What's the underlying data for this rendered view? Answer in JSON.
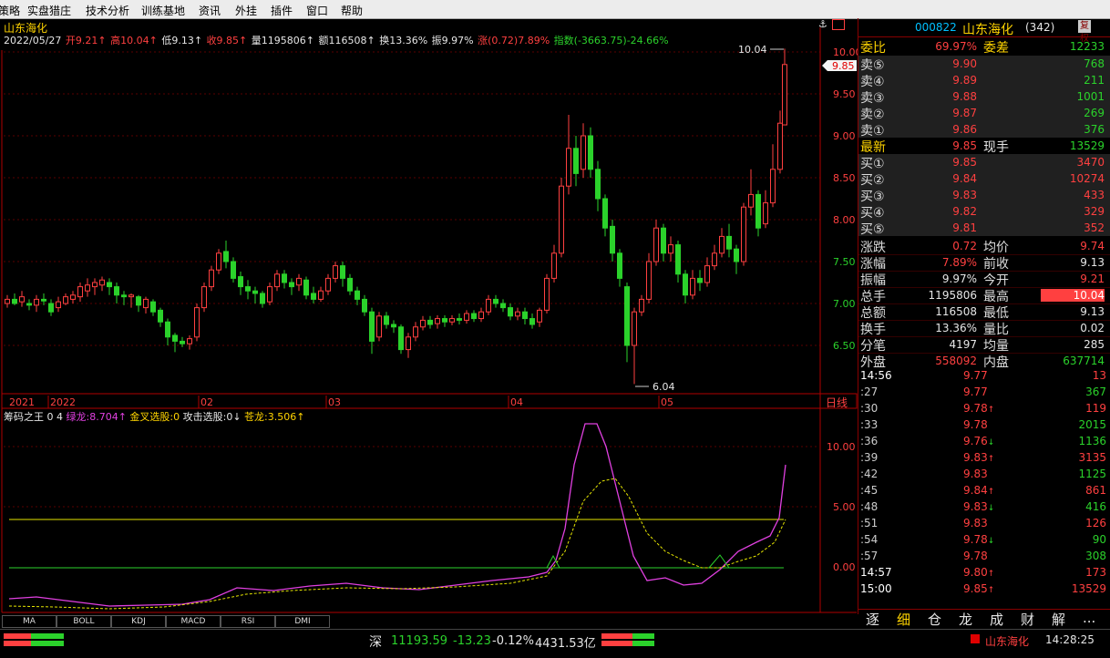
{
  "menu": {
    "items": [
      "策略",
      "实盘猎庄",
      "技术分析",
      "训练基地",
      "资讯",
      "外挂",
      "插件",
      "窗口",
      "帮助"
    ]
  },
  "stock": {
    "name": "山东海化",
    "code": "000822",
    "code_suffix": "(342)",
    "tag": "复权"
  },
  "info": {
    "date": "2022/05/27",
    "open": "开9.21↑",
    "high": "高10.04↑",
    "low": "低9.13↑",
    "close": "收9.85↑",
    "vol": "量1195806↑",
    "amount": "额116508↑",
    "turnover": "换13.36%",
    "amp": "振9.97%",
    "change": "涨(0.72)7.89%",
    "index": "指数(-3663.75)-24.66%"
  },
  "price_axis": {
    "labels": [
      "10.00",
      "9.50",
      "9.00",
      "8.50",
      "8.00",
      "7.50",
      "7.00",
      "6.50"
    ],
    "current_tag": "9.85",
    "high_mark": "10.04",
    "low_mark": "6.04"
  },
  "time_axis": {
    "labels": [
      "2021",
      "2022",
      "02",
      "03",
      "04",
      "05"
    ],
    "period": "日线"
  },
  "indicator": {
    "name": "筹码之王",
    "params": "0  4",
    "line1": "绿龙:8.704↑",
    "line2": "金叉选股:0",
    "line3": "攻击选股:0↓",
    "line4": "苍龙:3.506↑",
    "axis": [
      "10.00",
      "5.00",
      "0.00"
    ]
  },
  "tabs": [
    "MA",
    "BOLL",
    "KDJ",
    "MACD",
    "RSI",
    "DMI"
  ],
  "quote": {
    "weibi": {
      "label": "委比",
      "value": "69.97%",
      "label2": "委差",
      "value2": "12233"
    },
    "sell": [
      {
        "label": "卖⑤",
        "price": "9.90",
        "vol": "768"
      },
      {
        "label": "卖④",
        "price": "9.89",
        "vol": "211"
      },
      {
        "label": "卖③",
        "price": "9.88",
        "vol": "1001"
      },
      {
        "label": "卖②",
        "price": "9.87",
        "vol": "269"
      },
      {
        "label": "卖①",
        "price": "9.86",
        "vol": "376"
      }
    ],
    "last": {
      "label": "最新",
      "price": "9.85",
      "label2": "现手",
      "vol": "13529"
    },
    "buy": [
      {
        "label": "买①",
        "price": "9.85",
        "vol": "3470"
      },
      {
        "label": "买②",
        "price": "9.84",
        "vol": "10274"
      },
      {
        "label": "买③",
        "price": "9.83",
        "vol": "433"
      },
      {
        "label": "买④",
        "price": "9.82",
        "vol": "329"
      },
      {
        "label": "买⑤",
        "price": "9.81",
        "vol": "352"
      }
    ],
    "stats": [
      {
        "l1": "涨跌",
        "v1": "0.72",
        "c1": "red",
        "l2": "均价",
        "v2": "9.74",
        "c2": "red"
      },
      {
        "l1": "涨幅",
        "v1": "7.89%",
        "c1": "red",
        "l2": "前收",
        "v2": "9.13",
        "c2": "white"
      },
      {
        "l1": "振幅",
        "v1": "9.97%",
        "c1": "white",
        "l2": "今开",
        "v2": "9.21",
        "c2": "red"
      },
      {
        "l1": "总手",
        "v1": "1195806",
        "c1": "white",
        "l2": "最高",
        "v2": "10.04",
        "c2": "hl"
      },
      {
        "l1": "总额",
        "v1": "116508",
        "c1": "white",
        "l2": "最低",
        "v2": "9.13",
        "c2": "white"
      },
      {
        "l1": "换手",
        "v1": "13.36%",
        "c1": "white",
        "l2": "量比",
        "v2": "0.02",
        "c2": "white"
      },
      {
        "l1": "分笔",
        "v1": "4197",
        "c1": "white",
        "l2": "均量",
        "v2": "285",
        "c2": "white"
      }
    ],
    "outer": {
      "l1": "外盘",
      "v1": "558092",
      "l2": "内盘",
      "v2": "637714"
    }
  },
  "ticks": [
    {
      "t": "14:56",
      "p": "9.77",
      "a": "",
      "v": "13",
      "vc": "red"
    },
    {
      "t": ":27",
      "p": "9.77",
      "a": "",
      "v": "367",
      "vc": "green"
    },
    {
      "t": ":30",
      "p": "9.78",
      "a": "↑",
      "v": "119",
      "vc": "red"
    },
    {
      "t": ":33",
      "p": "9.78",
      "a": "",
      "v": "2015",
      "vc": "green"
    },
    {
      "t": ":36",
      "p": "9.76",
      "a": "↓",
      "v": "1136",
      "vc": "green"
    },
    {
      "t": ":39",
      "p": "9.83",
      "a": "↑",
      "v": "3135",
      "vc": "red"
    },
    {
      "t": ":42",
      "p": "9.83",
      "a": "",
      "v": "1125",
      "vc": "green"
    },
    {
      "t": ":45",
      "p": "9.84",
      "a": "↑",
      "v": "861",
      "vc": "red"
    },
    {
      "t": ":48",
      "p": "9.83",
      "a": "↓",
      "v": "416",
      "vc": "green"
    },
    {
      "t": ":51",
      "p": "9.83",
      "a": "",
      "v": "126",
      "vc": "red"
    },
    {
      "t": ":54",
      "p": "9.78",
      "a": "↓",
      "v": "90",
      "vc": "green"
    },
    {
      "t": ":57",
      "p": "9.78",
      "a": "",
      "v": "308",
      "vc": "green"
    },
    {
      "t": "14:57",
      "p": "9.80",
      "a": "↑",
      "v": "173",
      "vc": "red"
    },
    {
      "t": "15:00",
      "p": "9.85",
      "a": "↑",
      "v": "13529",
      "vc": "red"
    }
  ],
  "side_tabs": [
    "逐",
    "细",
    "仓",
    "龙",
    "成",
    "财",
    "解",
    "..."
  ],
  "status": {
    "market": "深",
    "index": "11193.59",
    "change": "-13.23",
    "pct": "-0.12%",
    "amount": "4431.53亿",
    "stock": "山东海化",
    "time": "14:28:25"
  },
  "colors": {
    "up": "#ff4040",
    "down": "#2bd22b",
    "label": "#ffd400",
    "grid": "#800000"
  }
}
